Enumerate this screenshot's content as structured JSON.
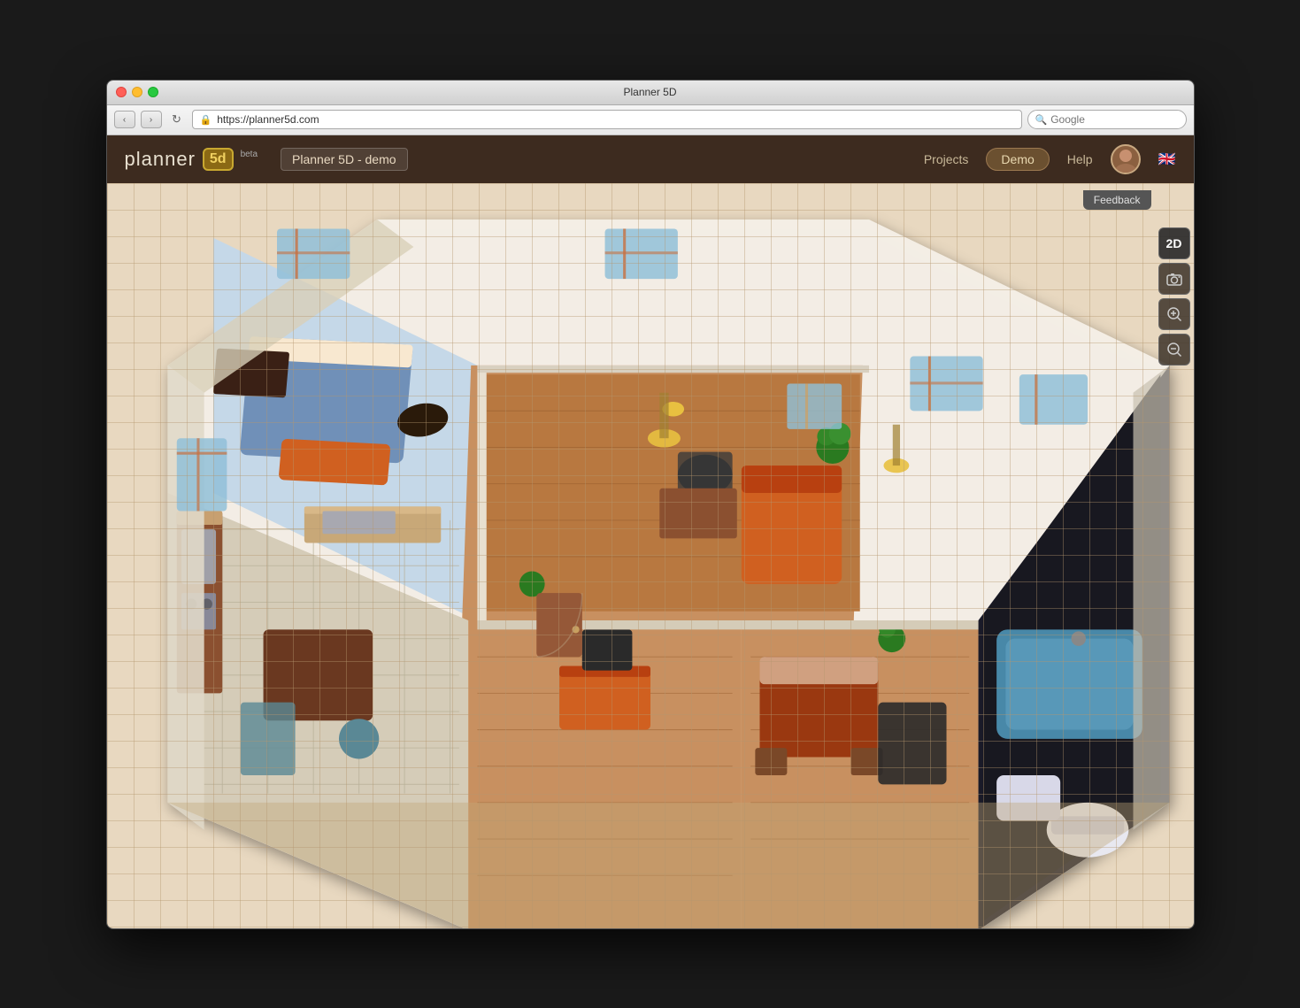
{
  "window": {
    "title": "Planner 5D",
    "url": "https://planner5d.com",
    "search_placeholder": "Google"
  },
  "app": {
    "logo_text": "planner",
    "logo_badge": "5d",
    "beta_label": "beta",
    "project_title": "Planner 5D - demo",
    "nav": {
      "projects_label": "Projects",
      "demo_label": "Demo",
      "help_label": "Help"
    }
  },
  "toolbar": {
    "feedback_label": "Feedback",
    "btn_2d_label": "2D",
    "btn_camera_label": "📷",
    "btn_zoom_in_label": "🔍",
    "btn_zoom_out_label": "🔎"
  },
  "colors": {
    "header_bg": "#3d2b1f",
    "canvas_bg": "#e8d8c0",
    "grid_color": "#c8a878",
    "wall_color": "#f0ebe0",
    "floor_wood": "#c8905a",
    "floor_tile": "#d8d0b8",
    "furniture_orange": "#d06020",
    "furniture_dark": "#5a3020",
    "accent_blue": "#4888b0",
    "accent_teal": "#208870"
  }
}
